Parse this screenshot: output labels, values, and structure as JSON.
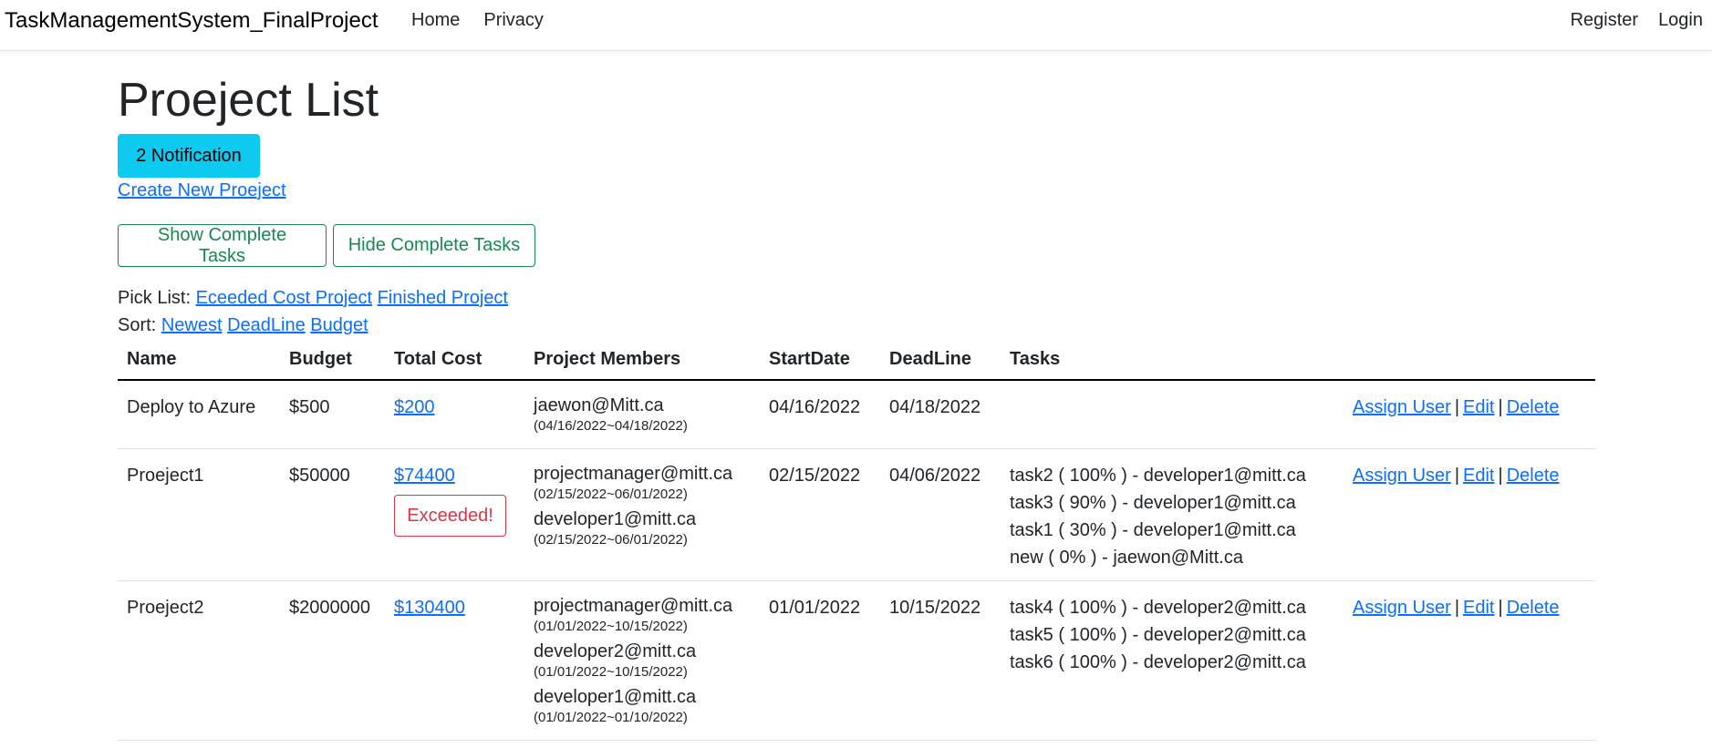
{
  "navbar": {
    "brand": "TaskManagementSystem_FinalProject",
    "left_links": [
      "Home",
      "Privacy"
    ],
    "right_links": [
      "Register",
      "Login"
    ]
  },
  "page": {
    "title": "Proeject List",
    "notification_button": "2 Notification",
    "create_link": "Create New Proeject",
    "show_complete_button": "Show Complete Tasks",
    "hide_complete_button": "Hide Complete Tasks",
    "pick_list_label": "Pick List:",
    "pick_list_links": [
      "Eceeded Cost Project",
      "Finished Project"
    ],
    "sort_label": "Sort:",
    "sort_links": [
      "Newest",
      "DeadLine",
      "Budget"
    ]
  },
  "table": {
    "headers": [
      "Name",
      "Budget",
      "Total Cost",
      "Project Members",
      "StartDate",
      "DeadLine",
      "Tasks",
      ""
    ],
    "action_labels": {
      "assign": "Assign User",
      "edit": "Edit",
      "delete": "Delete",
      "separator": "|"
    },
    "exceeded_label": "Exceeded!",
    "rows": [
      {
        "name": "Deploy to Azure",
        "budget": "$500",
        "total_cost": "$200",
        "exceeded": false,
        "members": [
          {
            "email": "jaewon@Mitt.ca",
            "range": "(04/16/2022~04/18/2022)"
          }
        ],
        "start_date": "04/16/2022",
        "deadline": "04/18/2022",
        "tasks": []
      },
      {
        "name": "Proeject1",
        "budget": "$50000",
        "total_cost": "$74400",
        "exceeded": true,
        "members": [
          {
            "email": "projectmanager@mitt.ca",
            "range": "(02/15/2022~06/01/2022)"
          },
          {
            "email": "developer1@mitt.ca",
            "range": "(02/15/2022~06/01/2022)"
          }
        ],
        "start_date": "02/15/2022",
        "deadline": "04/06/2022",
        "tasks": [
          "task2 ( 100% ) - developer1@mitt.ca",
          "task3 ( 90% ) - developer1@mitt.ca",
          "task1 ( 30% ) - developer1@mitt.ca",
          "new ( 0% ) - jaewon@Mitt.ca"
        ]
      },
      {
        "name": "Proeject2",
        "budget": "$2000000",
        "total_cost": "$130400",
        "exceeded": false,
        "members": [
          {
            "email": "projectmanager@mitt.ca",
            "range": "(01/01/2022~10/15/2022)"
          },
          {
            "email": "developer2@mitt.ca",
            "range": "(01/01/2022~10/15/2022)"
          },
          {
            "email": "developer1@mitt.ca",
            "range": "(01/01/2022~01/10/2022)"
          }
        ],
        "start_date": "01/01/2022",
        "deadline": "10/15/2022",
        "tasks": [
          "task4 ( 100% ) - developer2@mitt.ca",
          "task5 ( 100% ) - developer2@mitt.ca",
          "task6 ( 100% ) - developer2@mitt.ca"
        ]
      }
    ]
  }
}
